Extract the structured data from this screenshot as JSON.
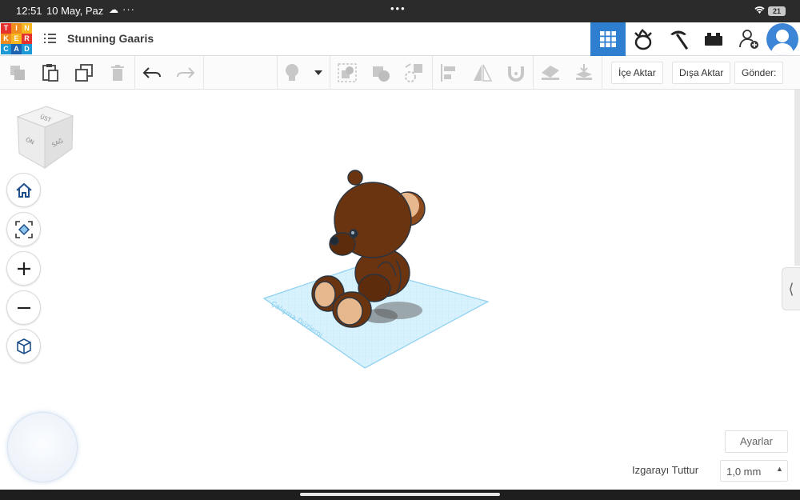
{
  "statusbar": {
    "time": "12:51",
    "date": "10 May, Paz",
    "more": "···",
    "center_dots": "•••",
    "battery": "21"
  },
  "header": {
    "logo_letters": [
      "T",
      "I",
      "N",
      "K",
      "E",
      "R",
      "C",
      "A",
      "D"
    ],
    "project_title": "Stunning Gaaris",
    "buttons": [
      "grid-view-icon",
      "circuits-icon",
      "codeblocks-icon",
      "bricks-icon",
      "add-user-icon"
    ]
  },
  "toolbar": {
    "import_label": "İçe Aktar",
    "export_label": "Dışa Aktar",
    "send_label": "Gönder:"
  },
  "viewcube": {
    "top_label": "ÜST",
    "front_label": "ÖN",
    "right_label": "SAĞ"
  },
  "workplane": {
    "label": "Çalışma Düzlemi"
  },
  "bottom": {
    "settings_label": "Ayarlar",
    "snap_label": "Izgarayı Tuttur",
    "snap_value": "1,0 mm"
  },
  "colors": {
    "accent": "#2f7fd1",
    "bear_body": "#6b3410",
    "bear_ear": "#e7b88e",
    "workplane": "#cdeefc"
  }
}
